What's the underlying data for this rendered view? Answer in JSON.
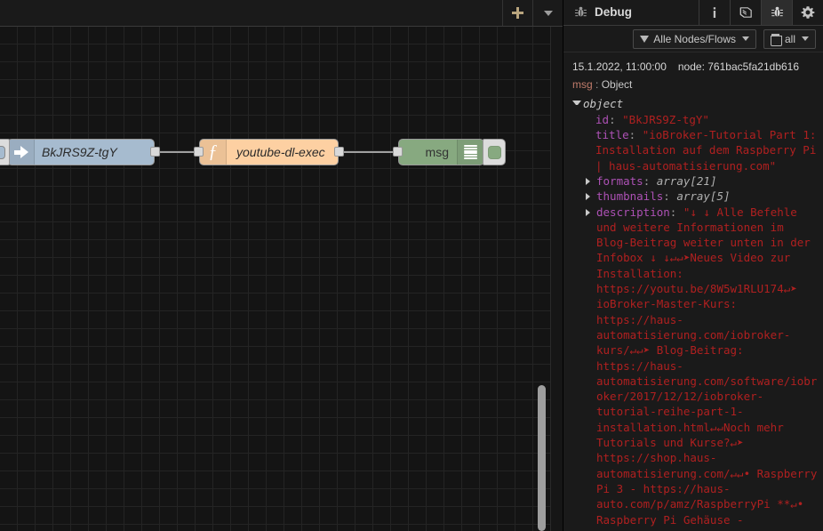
{
  "editor": {
    "toolbar": {
      "add_label": "+",
      "add_icon": "plus-icon",
      "menu_icon": "chevron-down-icon"
    },
    "nodes": [
      {
        "id": "inject",
        "label": "BkJRS9Z-tgY",
        "type": "inject",
        "icon": "arrow-right-icon",
        "color": "#a6bbcf"
      },
      {
        "id": "function",
        "label": "youtube-dl-exec",
        "type": "function",
        "icon": "function-f-icon",
        "color": "#fdd0a2"
      },
      {
        "id": "debug",
        "label": "msg",
        "type": "debug",
        "icon": "debug-lines-icon",
        "color": "#87a980"
      }
    ]
  },
  "sidebar": {
    "title": "Debug",
    "title_icon": "bug-icon",
    "tabs": [
      {
        "name": "information",
        "icon": "info-icon",
        "active": false
      },
      {
        "name": "help",
        "icon": "book-icon",
        "active": false
      },
      {
        "name": "debug",
        "icon": "bug-icon",
        "active": true
      },
      {
        "name": "config",
        "icon": "gear-icon",
        "active": false
      }
    ],
    "filter": {
      "scope_label": "Alle Nodes/Flows",
      "scope_icon": "funnel-icon",
      "clear_label": "all",
      "clear_icon": "trash-icon"
    },
    "message": {
      "timestamp": "15.1.2022, 11:00:00",
      "node_label": "node:",
      "node_id": "761bac5fa21db616",
      "property": "msg",
      "separator": ":",
      "type": "Object",
      "root_label": "object",
      "fields": [
        {
          "key": "id",
          "value": "\"BkJRS9Z-tgY\"",
          "kind": "string",
          "twist": "none"
        },
        {
          "key": "title",
          "value": "\"ioBroker-Tutorial Part 1: Installation auf dem Raspberry Pi | haus-automatisierung.com\"",
          "kind": "string",
          "twist": "none"
        },
        {
          "key": "formats",
          "value": "array[21]",
          "kind": "meta",
          "twist": "right"
        },
        {
          "key": "thumbnails",
          "value": "array[5]",
          "kind": "meta",
          "twist": "right"
        },
        {
          "key": "description",
          "value": "\"↓ ↓ Alle Befehle und weitere Informationen im Blog-Beitrag weiter unten in der Infobox ↓ ↓↵↵➤Neues Video zur Installation: https://youtu.be/8W5w1RLU174↵➤ ioBroker-Master-Kurs: https://haus-automatisierung.com/iobroker-kurs/↵↵➤ Blog-Beitrag: https://haus-automatisierung.com/software/iobroker/2017/12/12/iobroker-tutorial-reihe-part-1-installation.html↵↵Noch mehr Tutorials und Kurse?↵➤ https://shop.haus-automatisierung.com/↵↵• Raspberry Pi 3 - https://haus-auto.com/p/amz/RaspberryPi **↵• Raspberry Pi Gehäuse -",
          "kind": "string",
          "twist": "right"
        }
      ]
    }
  },
  "colors": {
    "canvas_bg": "#141414",
    "grid_line": "#242424",
    "panel_bg": "#1a1a1a",
    "key": "#ad51b5",
    "string": "#b02020",
    "meta": "#b0b0b0",
    "inject_node": "#a6bbcf",
    "function_node": "#fdd0a2",
    "debug_node": "#87a980"
  }
}
